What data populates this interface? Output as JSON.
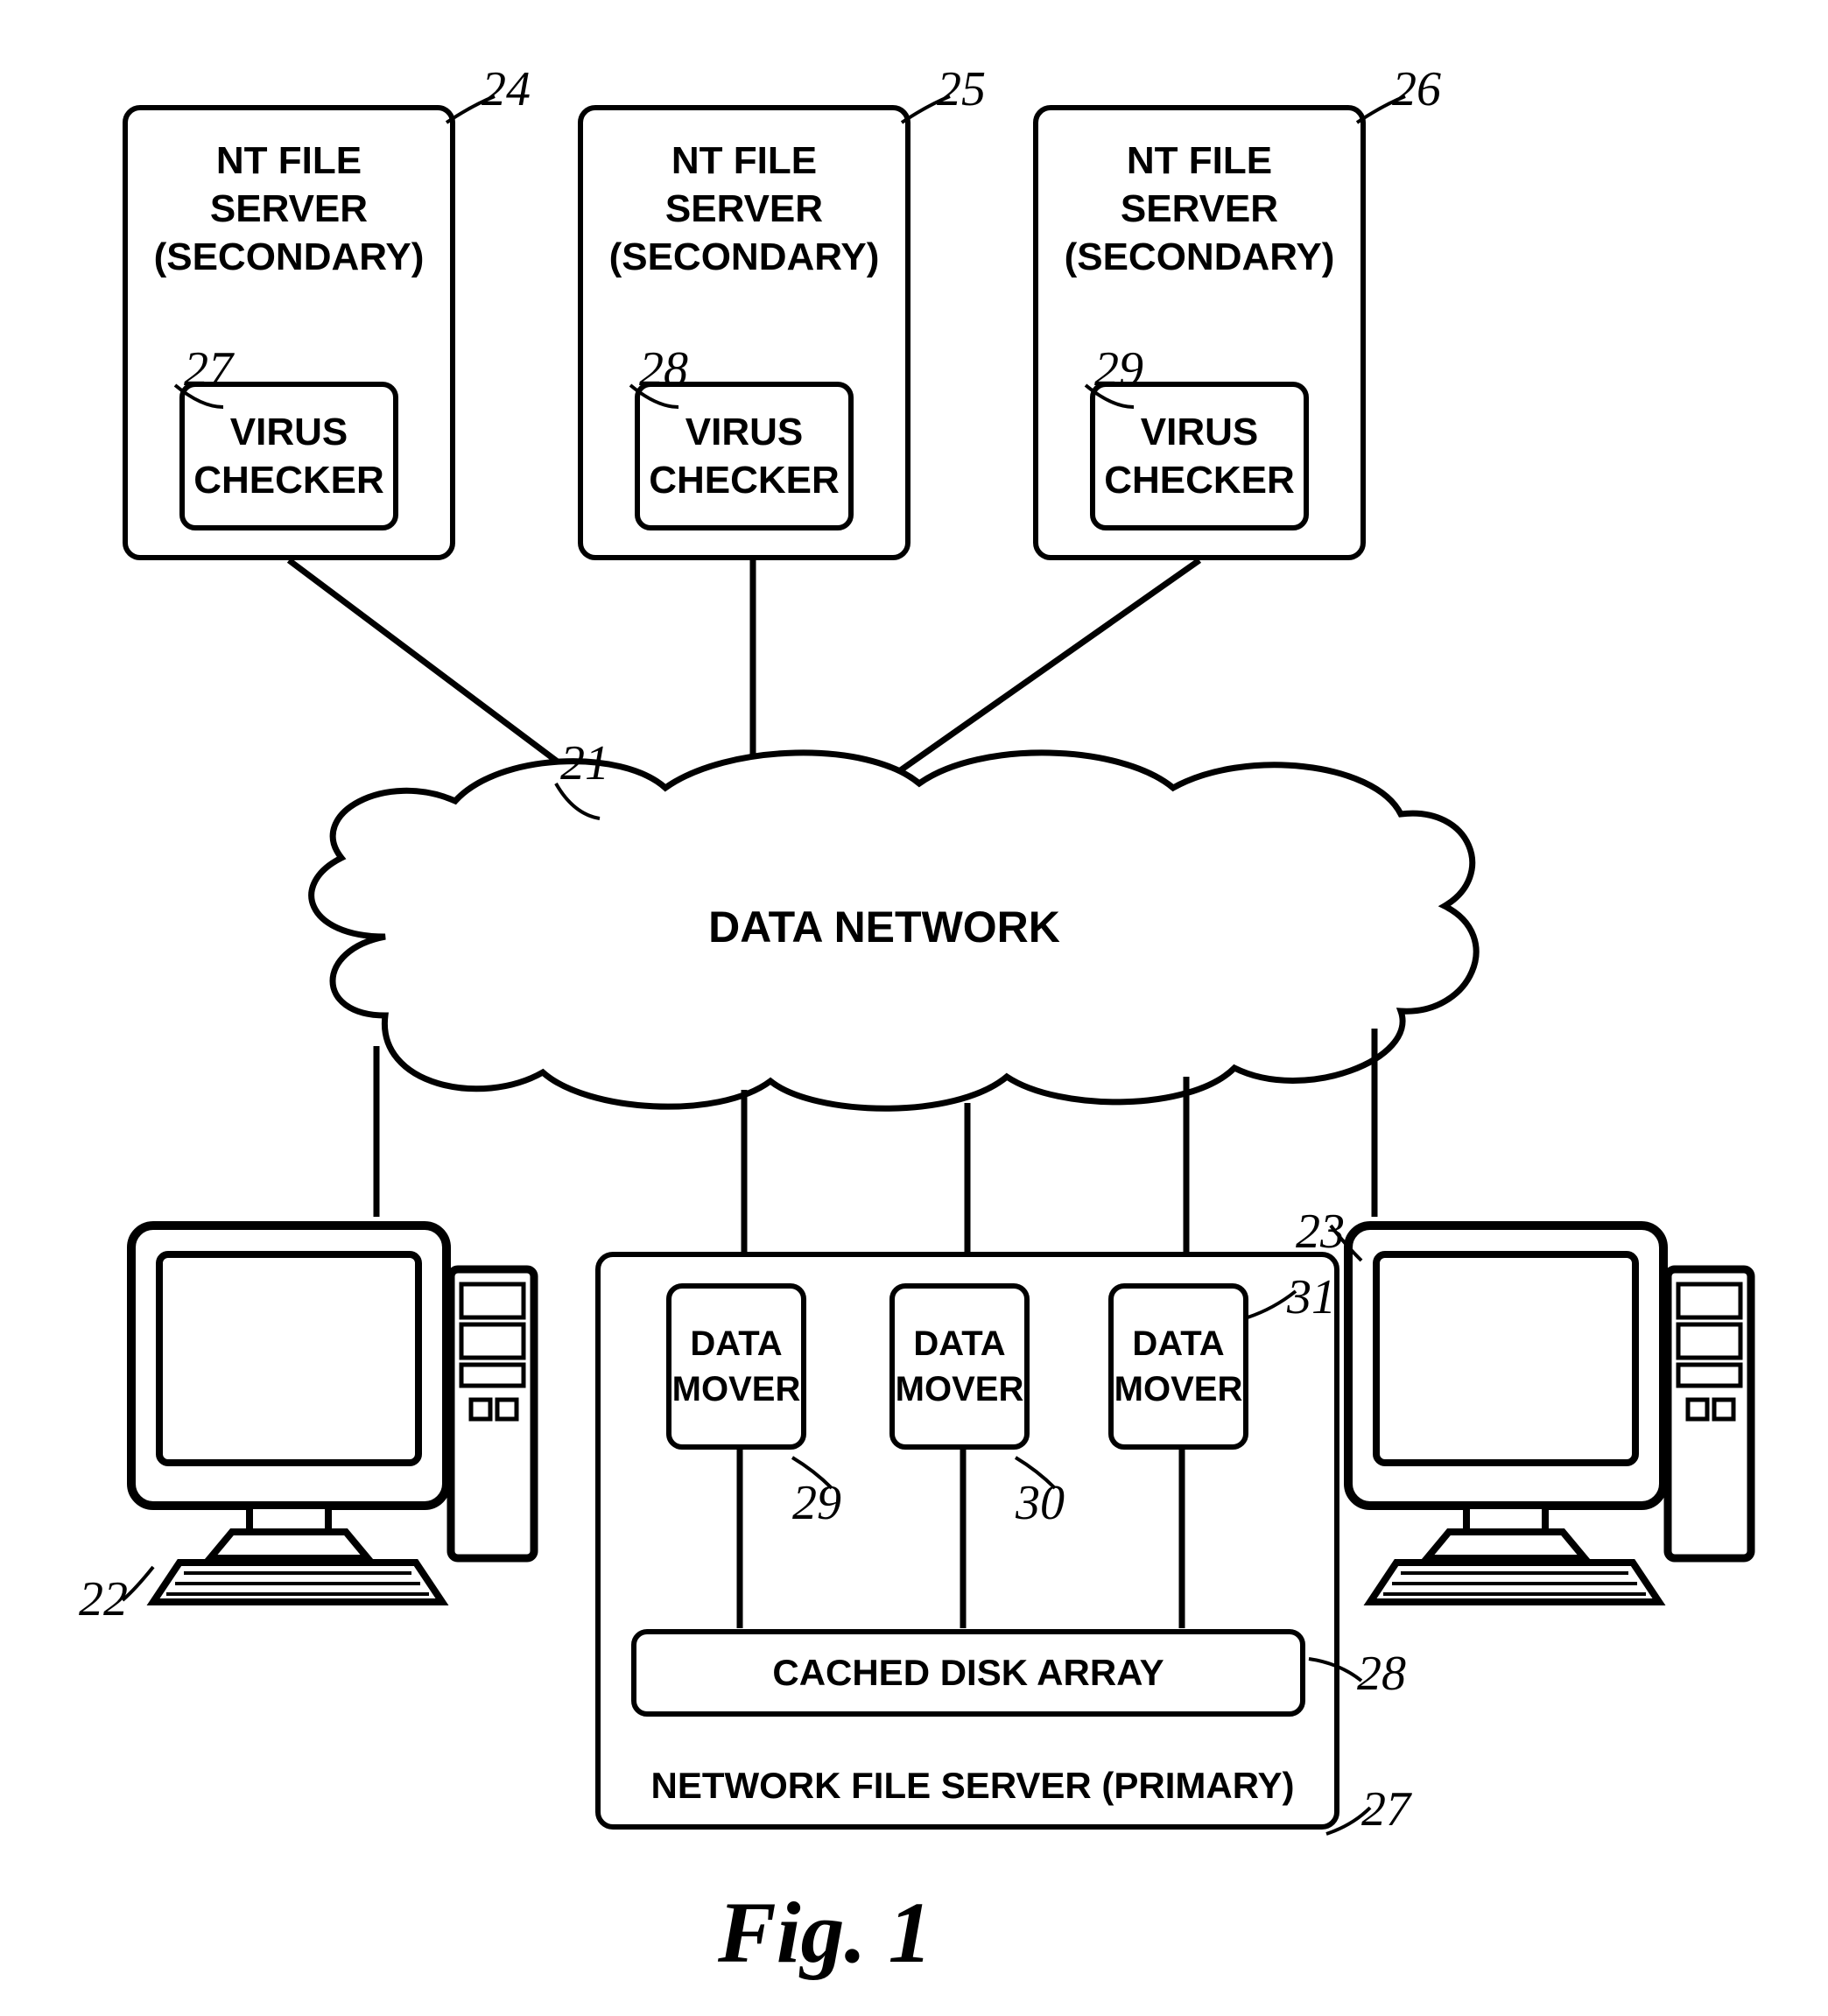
{
  "servers": [
    {
      "title": "NT FILE\nSERVER\n(SECONDARY)",
      "virus": "VIRUS\nCHECKER",
      "boxRef": "24",
      "virusRef": "27"
    },
    {
      "title": "NT FILE\nSERVER\n(SECONDARY)",
      "virus": "VIRUS\nCHECKER",
      "boxRef": "25",
      "virusRef": "28"
    },
    {
      "title": "NT FILE\nSERVER\n(SECONDARY)",
      "virus": "VIRUS\nCHECKER",
      "boxRef": "26",
      "virusRef": "29"
    }
  ],
  "cloud": {
    "label": "DATA NETWORK",
    "ref": "21"
  },
  "workstations": [
    {
      "ref": "22"
    },
    {
      "ref": "23"
    }
  ],
  "primary": {
    "label": "NETWORK FILE SERVER (PRIMARY)",
    "ref": "27",
    "cachedDisk": {
      "label": "CACHED DISK ARRAY",
      "ref": "28"
    },
    "dataMovers": [
      {
        "label": "DATA\nMOVER",
        "ref": "29"
      },
      {
        "label": "DATA\nMOVER",
        "ref": "30"
      },
      {
        "label": "DATA\nMOVER",
        "ref": "31"
      }
    ]
  },
  "figure": "Fig. 1"
}
